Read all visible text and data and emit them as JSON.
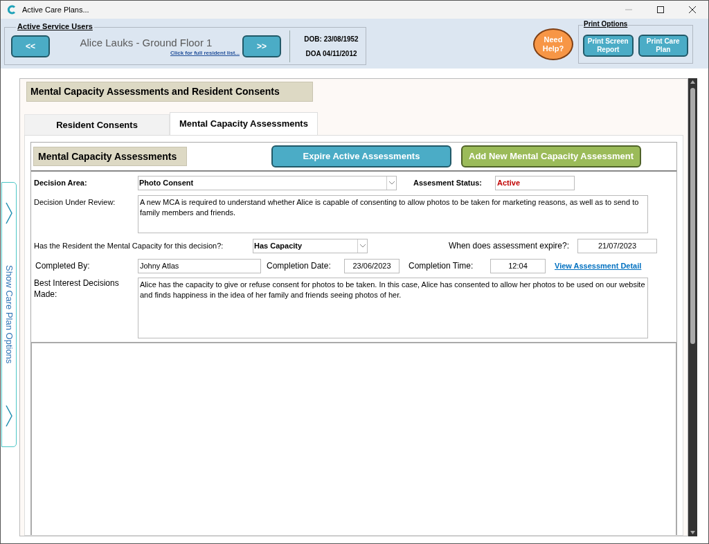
{
  "window": {
    "title": "Active Care Plans..."
  },
  "header": {
    "group_title": "Active Service Users",
    "prev_button": "<<",
    "resident_name": "Alice Lauks - Ground Floor 1",
    "resident_list_link": "Click for full resident list...",
    "next_button": ">>",
    "dob": "DOB: 23/08/1952",
    "doa": "DOA 04/11/2012",
    "help_button": "Need Help?",
    "print_options": {
      "title": "Print Options",
      "buttons": [
        "Print Screen Report",
        "Print Care Plan"
      ]
    }
  },
  "side_tab": {
    "label": "Show Care Plan Options"
  },
  "page_title": "Mental Capacity Assessments and Resident Consents",
  "tabs": [
    {
      "label": "Resident Consents",
      "selected": false
    },
    {
      "label": "Mental Capacity Assessments",
      "selected": true
    }
  ],
  "panel": {
    "title": "Mental Capacity Assessments",
    "buttons": [
      {
        "label": "Expire Active Assessments",
        "kind": "expire"
      },
      {
        "label": "Add New Mental Capacity Assessment",
        "kind": "add"
      }
    ]
  },
  "form": {
    "decision_area": {
      "label": "Decision Area:",
      "value": "Photo Consent"
    },
    "status": {
      "label": "Assesment Status:",
      "value": "Active"
    },
    "decision_under_review": {
      "label": "Decision Under Review:",
      "value": "A new MCA is required to understand whether Alice is capable of consenting to allow photos to be taken for marketing reasons, as well as to send to family members and friends."
    },
    "capacity": {
      "label": "Has the Resident the Mental Capacity for this decision?:",
      "value": "Has Capacity"
    },
    "expiry": {
      "label": "When does assessment expire?:",
      "value": "21/07/2023"
    },
    "completed_by": {
      "label": "Completed By:",
      "value": "Johny Atlas"
    },
    "completion_date": {
      "label": "Completion Date:",
      "value": "23/06/2023"
    },
    "completion_time": {
      "label": "Completion Time:",
      "value": "12:04"
    },
    "detail_link": "View Assessment Detail",
    "best_interest": {
      "label": "Best Interest Decisions Made:",
      "value": "Alice has the capacity to give or refuse consent for photos to be taken. In this case, Alice has consented to allow her photos to be used on our website and finds happiness in the idea of her family and friends seeing photos of her."
    }
  }
}
